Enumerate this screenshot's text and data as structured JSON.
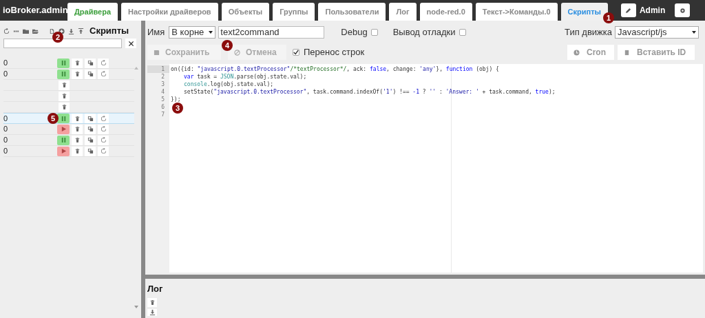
{
  "app_title": "ioBroker.admin",
  "tabs": [
    {
      "label": "Драйвера",
      "kind": "home",
      "selected": false
    },
    {
      "label": "Настройки драйверов",
      "kind": "tab",
      "selected": false
    },
    {
      "label": "Объекты",
      "kind": "tab",
      "selected": false
    },
    {
      "label": "Группы",
      "kind": "tab",
      "selected": false
    },
    {
      "label": "Пользователи",
      "kind": "tab",
      "selected": false
    },
    {
      "label": "Лог",
      "kind": "tab",
      "selected": false
    },
    {
      "label": "node-red.0",
      "kind": "tab",
      "selected": false
    },
    {
      "label": "Текст->Команды.0",
      "kind": "tab",
      "selected": false
    },
    {
      "label": "Скрипты",
      "kind": "tab",
      "selected": true
    }
  ],
  "user": "Admin",
  "sidebar": {
    "title": "Скрипты",
    "rows": [
      {
        "name": "0",
        "kind": "script",
        "running": true,
        "selected": false
      },
      {
        "name": "0",
        "kind": "script",
        "running": true,
        "selected": false
      },
      {
        "kind": "folder",
        "selected": false
      },
      {
        "kind": "folder",
        "selected": false
      },
      {
        "kind": "folder",
        "selected": false
      },
      {
        "name": "0",
        "kind": "script",
        "running": true,
        "selected": true
      },
      {
        "name": "0",
        "kind": "script",
        "running": false,
        "selected": false
      },
      {
        "name": "0",
        "kind": "script",
        "running": true,
        "selected": false
      },
      {
        "name": "0",
        "kind": "script",
        "running": false,
        "selected": false
      }
    ]
  },
  "editor": {
    "name_label": "Имя",
    "folder": "В корне",
    "name_value": "text2command",
    "debug": {
      "label": "Debug",
      "checked": false
    },
    "verbose": {
      "label": "Вывод отладки",
      "checked": false
    },
    "engine_label": "Тип движка",
    "engine": "Javascript/js",
    "save": {
      "label": "Сохранить",
      "disabled": true
    },
    "cancel": {
      "label": "Отмена",
      "disabled": true
    },
    "wrap": {
      "label": "Перенос строк",
      "checked": true
    },
    "cron": "Cron",
    "insert_id": "Вставить ID",
    "lines": [
      {
        "number": "1",
        "indent": false,
        "tokens": [
          {
            "kind": "plain",
            "s": "on({id: "
          },
          {
            "kind": "string",
            "s": "\"javascript.0.textProcessor\""
          },
          {
            "kind": "comment",
            "s": "/*textProcessor*/"
          },
          {
            "kind": "plain",
            "s": ", ack: "
          },
          {
            "kind": "keyword",
            "s": "false"
          },
          {
            "kind": "plain",
            "s": ", change: "
          },
          {
            "kind": "string",
            "s": "'any'"
          },
          {
            "kind": "plain",
            "s": "}, "
          },
          {
            "kind": "keyword",
            "s": "function"
          },
          {
            "kind": "plain",
            "s": " (obj) {"
          }
        ]
      },
      {
        "number": "2",
        "indent": true,
        "tokens": [
          {
            "kind": "keyword",
            "s": "var"
          },
          {
            "kind": "plain",
            "s": " task = "
          },
          {
            "kind": "builtin",
            "s": "JSON"
          },
          {
            "kind": "plain",
            "s": ".parse(obj.state.val);"
          }
        ]
      },
      {
        "number": "3",
        "indent": true,
        "tokens": [
          {
            "kind": "builtin",
            "s": "console"
          },
          {
            "kind": "plain",
            "s": ".log(obj.state.val);"
          }
        ]
      },
      {
        "number": "4",
        "indent": true,
        "tokens": [
          {
            "kind": "plain",
            "s": "setState("
          },
          {
            "kind": "string",
            "s": "\"javascript.0.textProcessor\""
          },
          {
            "kind": "plain",
            "s": ", task.command.indexOf("
          },
          {
            "kind": "string",
            "s": "'1'"
          },
          {
            "kind": "plain",
            "s": ") !== "
          },
          {
            "kind": "number",
            "s": "-1"
          },
          {
            "kind": "plain",
            "s": " ? "
          },
          {
            "kind": "string",
            "s": "''"
          },
          {
            "kind": "plain",
            "s": " : "
          },
          {
            "kind": "string",
            "s": "'Answer: '"
          },
          {
            "kind": "plain",
            "s": " + task.command, "
          },
          {
            "kind": "keyword",
            "s": "true"
          },
          {
            "kind": "plain",
            "s": ");"
          }
        ]
      },
      {
        "number": "5",
        "indent": false,
        "tokens": [
          {
            "kind": "plain",
            "s": "});"
          }
        ]
      },
      {
        "number": "6"
      },
      {
        "number": "7"
      }
    ]
  },
  "log": {
    "title": "Лог"
  },
  "markers": [
    "1",
    "2",
    "3",
    "4",
    "5"
  ]
}
